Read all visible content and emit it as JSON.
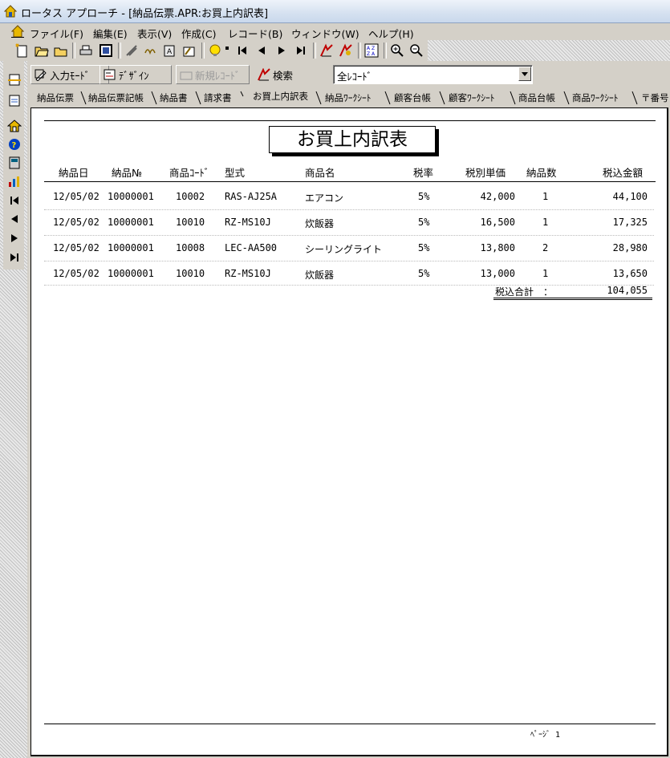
{
  "window": {
    "title": "ロータス アプローチ - [納品伝票.APR:お買上内訳表]"
  },
  "menu": [
    "ファイル(F)",
    "編集(E)",
    "表示(V)",
    "作成(C)",
    "レコード(B)",
    "ウィンドウ(W)",
    "ヘルプ(H)"
  ],
  "toolbar2": {
    "input_mode": "入力ﾓｰﾄﾞ",
    "design": "ﾃﾞｻﾞｲﾝ",
    "new_record": "新規ﾚｺｰﾄﾞ",
    "search": "検索",
    "record_filter": "全ﾚｺｰﾄﾞ"
  },
  "tabs": [
    "納品伝票",
    "納品伝票記帳",
    "納品書",
    "請求書",
    "お買上内訳表",
    "納品ﾜｰｸｼｰﾄ",
    "顧客台帳",
    "顧客ﾜｰｸｼｰﾄ",
    "商品台帳",
    "商品ﾜｰｸｼｰﾄ",
    "〒番号"
  ],
  "active_tab": "お買上内訳表",
  "report": {
    "title": "お買上内訳表",
    "columns": [
      "納品日",
      "納品№",
      "商品ｺｰﾄﾞ",
      "型式",
      "商品名",
      "税率",
      "税別単価",
      "納品数",
      "税込金額"
    ],
    "rows": [
      [
        "12/05/02",
        "10000001",
        "10002",
        "RAS-AJ25A",
        "エアコン",
        "5%",
        "42,000",
        "1",
        "44,100"
      ],
      [
        "12/05/02",
        "10000001",
        "10010",
        "RZ-MS10J",
        "炊飯器",
        "5%",
        "16,500",
        "1",
        "17,325"
      ],
      [
        "12/05/02",
        "10000001",
        "10008",
        "LEC-AA500",
        "シーリングライト",
        "5%",
        "13,800",
        "2",
        "28,980"
      ],
      [
        "12/05/02",
        "10000001",
        "10010",
        "RZ-MS10J",
        "炊飯器",
        "5%",
        "13,000",
        "1",
        "13,650"
      ]
    ],
    "total_label": "税込合計　：",
    "total_value": "104,055",
    "footer_page": "ﾍﾟｰｼﾞ 1"
  }
}
